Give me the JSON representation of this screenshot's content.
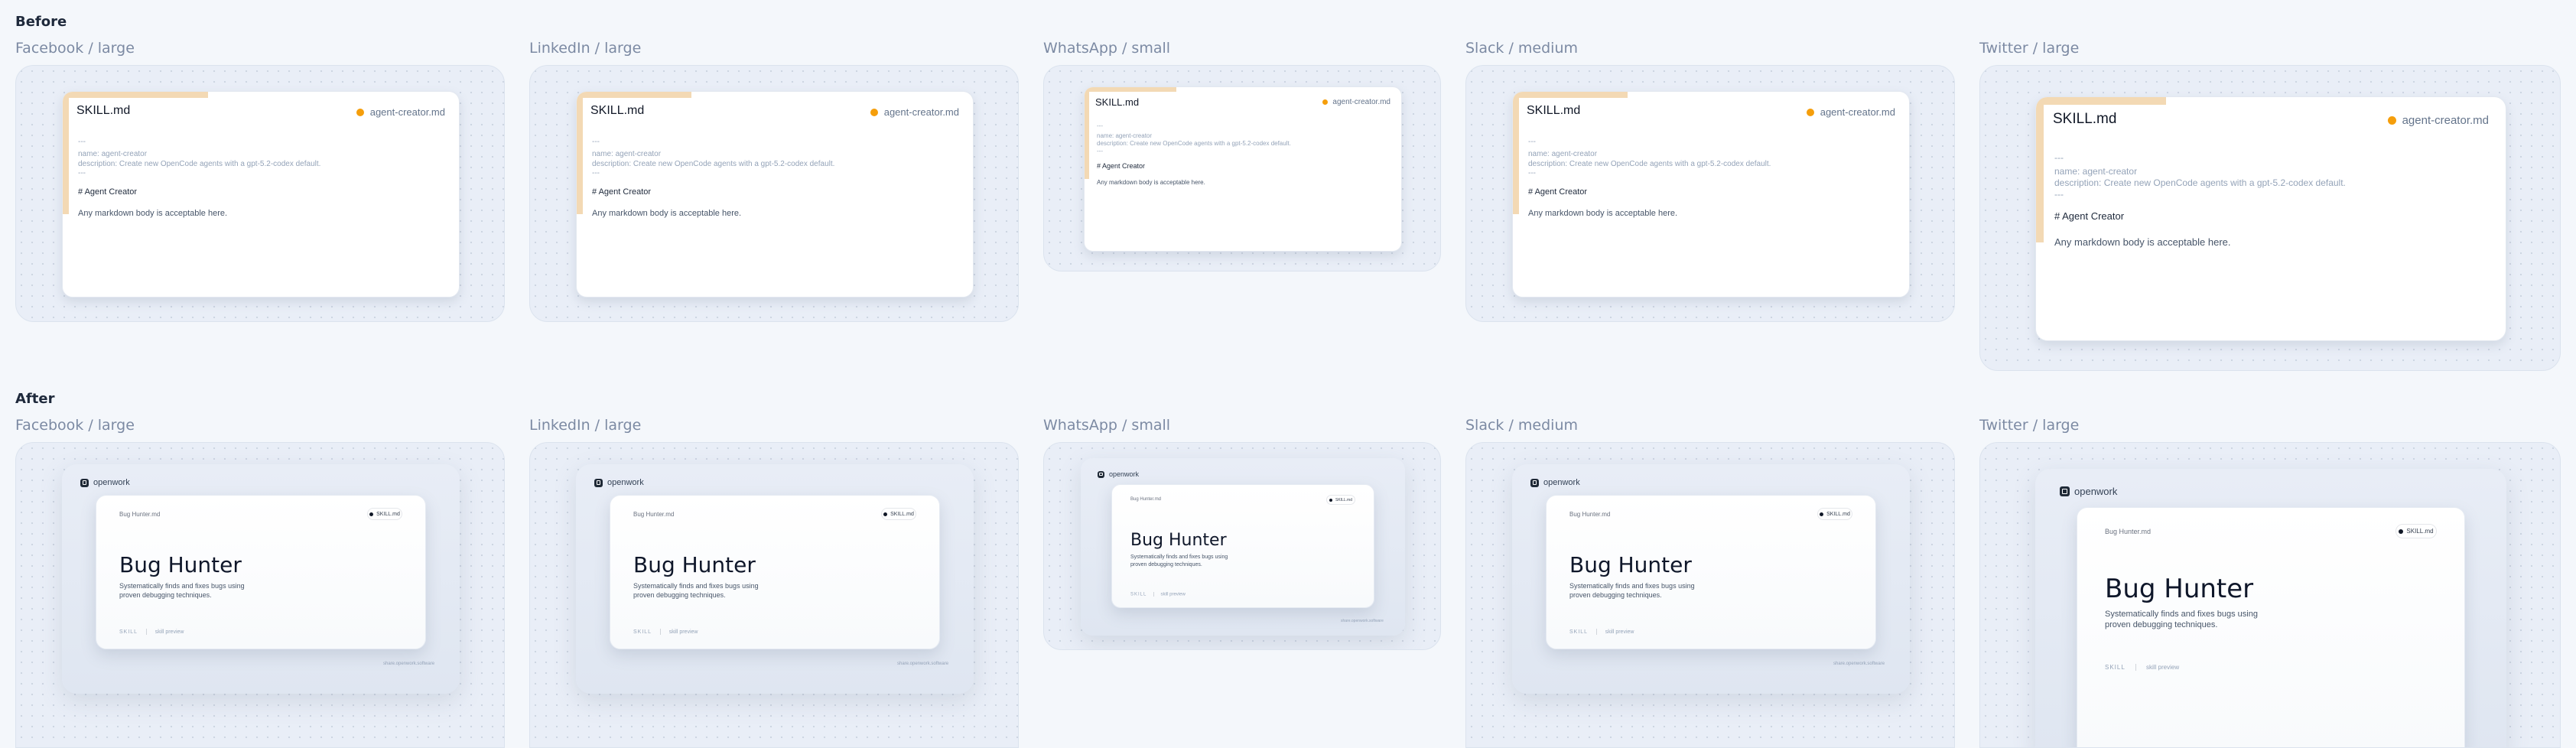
{
  "sections": {
    "before": "Before",
    "after": "After"
  },
  "labels": [
    "Facebook / large",
    "LinkedIn / large",
    "WhatsApp / small",
    "Slack / medium",
    "Twitter / large"
  ],
  "before_card": {
    "title": "SKILL.md",
    "badge": "agent-creator.md",
    "dashes_open": "---",
    "name_line": "name: agent-creator",
    "description_line": "description: Create new OpenCode agents with a gpt-5.2-codex default.",
    "dashes_close": "---",
    "heading": "# Agent Creator",
    "body": "Any markdown body is acceptable here.",
    "accent_color": "#f59e0b"
  },
  "after_card": {
    "brand": "openwork",
    "top_label": "Bug Hunter.md",
    "pill": "SKILL.md",
    "title": "Bug Hunter",
    "description": "Systematically finds and fixes bugs using proven debugging techniques.",
    "footer_left": "SKILL",
    "footer_right": "skill preview",
    "credit": "share.openwork.software"
  }
}
